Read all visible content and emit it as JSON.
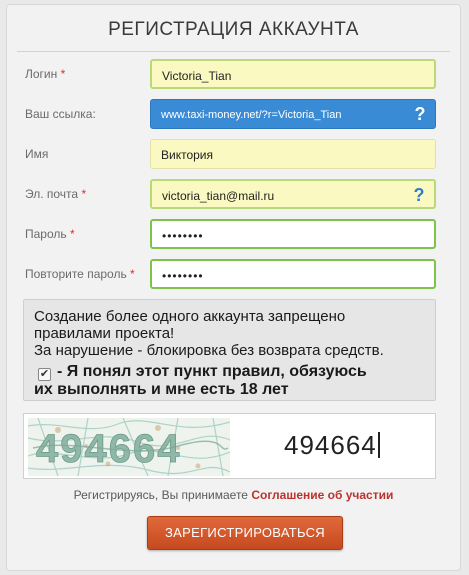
{
  "form": {
    "title": "РЕГИСТРАЦИЯ АККАУНТА",
    "required_mark": "*",
    "login": {
      "label": "Логин",
      "value": "Victoria_Tian"
    },
    "ref_link": {
      "label": "Ваш ссылка:",
      "value": "www.taxi-money.net/?r=Victoria_Tian",
      "help": "?"
    },
    "name": {
      "label": "Имя",
      "value": "Виктория"
    },
    "email": {
      "label": "Эл. почта",
      "value": "victoria_tian@mail.ru",
      "help": "?"
    },
    "password": {
      "label": "Пароль",
      "value": "••••••••"
    },
    "password_repeat": {
      "label": "Повторите пароль",
      "value": "••••••••"
    }
  },
  "warning": {
    "line1": "Создание более одного аккаунта запрещено",
    "line2": "правилами проекта!",
    "line3": "За нарушение - блокировка без возврата средств.",
    "agree_text": "- Я понял этот пункт правил, обязуюсь",
    "agree_text2": "их выполнять и мне есть 18 лет",
    "agree_checked": "✔"
  },
  "captcha": {
    "image_digits": "494664",
    "input_value": "494664"
  },
  "terms": {
    "prefix": "Регистрируясь, Вы принимаете",
    "link": "Соглашение об участии"
  },
  "submit_label": "ЗАРЕГИСТРИРОВАТЬСЯ",
  "colors": {
    "accent_blue": "#3a8bd6",
    "submit_orange": "#d2582b",
    "required_red": "#d9312a",
    "valid_green": "#7dc34a"
  }
}
